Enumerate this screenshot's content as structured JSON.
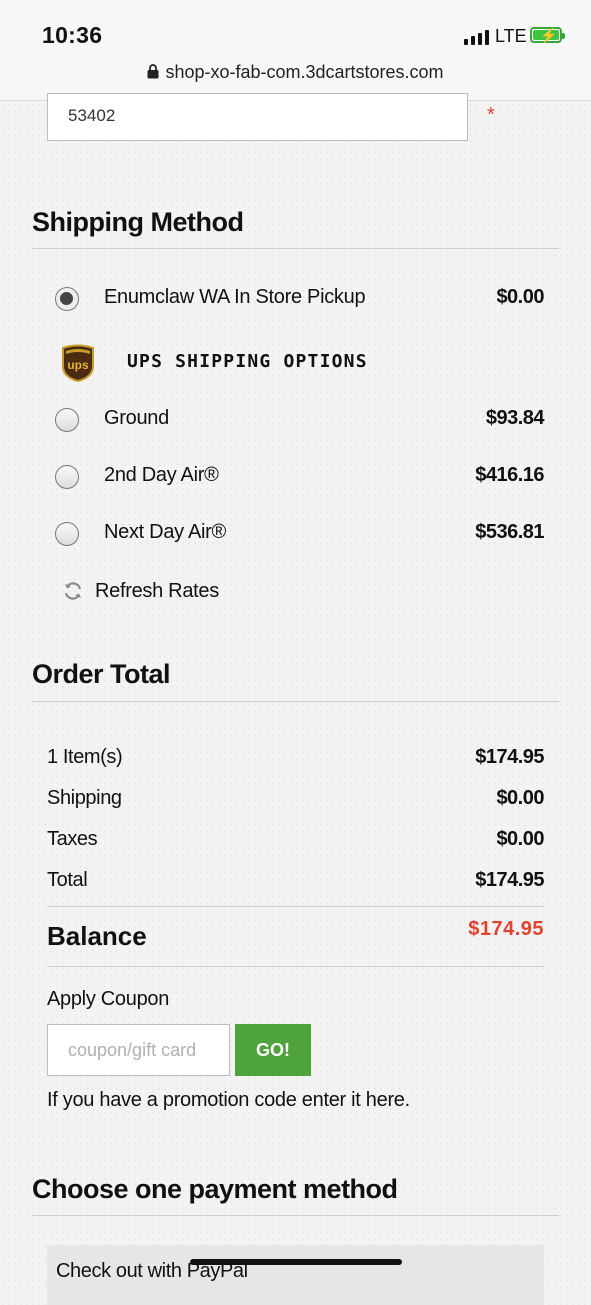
{
  "status_bar": {
    "time": "10:36",
    "network": "LTE",
    "url": "shop-xo-fab-com.3dcartstores.com"
  },
  "address": {
    "zip_value": "53402",
    "required_mark": "*"
  },
  "shipping": {
    "heading": "Shipping Method",
    "pickup": {
      "label": "Enumclaw WA In Store Pickup",
      "price": "$0.00",
      "selected": true
    },
    "ups_heading": "UPS SHIPPING OPTIONS",
    "ups_logo_text": "ups",
    "options": [
      {
        "label": "Ground",
        "price": "$93.84",
        "selected": false
      },
      {
        "label": "2nd Day Air®",
        "price": "$416.16",
        "selected": false
      },
      {
        "label": "Next Day Air®",
        "price": "$536.81",
        "selected": false
      }
    ],
    "refresh_label": "Refresh Rates"
  },
  "order_total": {
    "heading": "Order Total",
    "rows": [
      {
        "label": "1 Item(s)",
        "value": "$174.95"
      },
      {
        "label": "Shipping",
        "value": "$0.00"
      },
      {
        "label": "Taxes",
        "value": "$0.00"
      },
      {
        "label": "Total",
        "value": "$174.95"
      }
    ],
    "balance_label": "Balance",
    "balance_value": "$174.95"
  },
  "coupon": {
    "title": "Apply Coupon",
    "placeholder": "coupon/gift card",
    "button": "GO!",
    "hint": "If you have a promotion code enter it here."
  },
  "payment": {
    "heading": "Choose one payment method",
    "paypal_label": "Check out with PayPal"
  },
  "colors": {
    "accent_green": "#4ea33b",
    "balance_red": "#e0422f"
  }
}
